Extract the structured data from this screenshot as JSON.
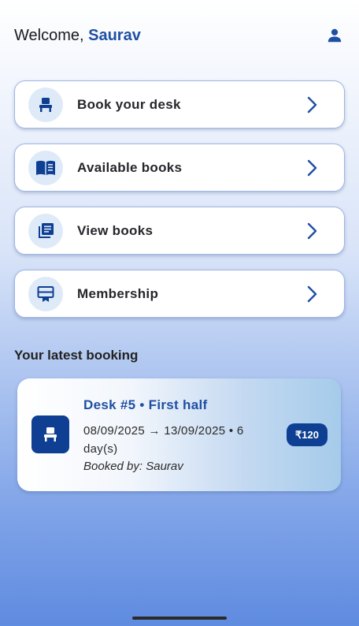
{
  "header": {
    "greeting": "Welcome, ",
    "user_name": "Saurav",
    "profile_icon": "person-icon"
  },
  "menu": [
    {
      "label": "Book your desk",
      "icon": "desk-chair-icon"
    },
    {
      "label": "Available books",
      "icon": "open-book-icon"
    },
    {
      "label": "View books",
      "icon": "library-books-icon"
    },
    {
      "label": "Membership",
      "icon": "membership-card-icon"
    }
  ],
  "latest_booking": {
    "section_title": "Your latest booking",
    "title": "Desk #5 • First half",
    "dates": "08/09/2025 → 13/09/2025  •  6 day(s)",
    "booked_by": "Booked by: Saurav",
    "price": "₹120",
    "icon": "desk-chair-icon"
  },
  "colors": {
    "accent": "#1f4fa3",
    "dark_accent": "#0e3f92",
    "icon_bg": "#dfeaf8"
  }
}
